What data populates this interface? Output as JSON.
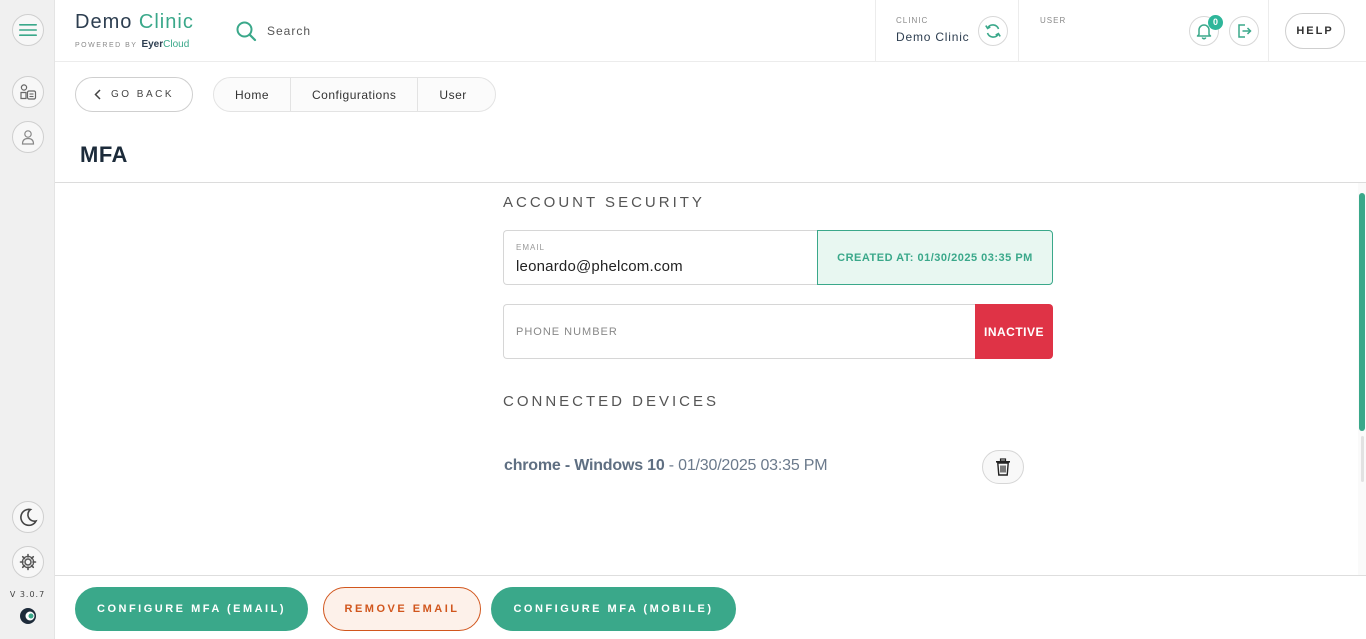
{
  "sidebar": {
    "version": "V 3.0.7"
  },
  "header": {
    "brand_first": "Demo",
    "brand_second": "Clinic",
    "powered_by": "POWERED BY",
    "powered_eyer": "Eyer",
    "powered_cloud": "Cloud",
    "search_placeholder": "Search",
    "clinic_label": "CLINIC",
    "clinic_value": "Demo Clinic",
    "user_label": "USER",
    "notification_count": "0",
    "help_label": "HELP"
  },
  "nav": {
    "go_back_label": "GO BACK",
    "breadcrumb": [
      "Home",
      "Configurations",
      "User"
    ]
  },
  "page": {
    "title": "MFA"
  },
  "account_security": {
    "heading": "ACCOUNT SECURITY",
    "email_label": "EMAIL",
    "email_value": "leonardo@phelcom.com",
    "created_at": "CREATED AT: 01/30/2025 03:35 PM",
    "phone_label": "PHONE NUMBER",
    "phone_status": "INACTIVE"
  },
  "connected_devices": {
    "heading": "CONNECTED DEVICES",
    "devices": [
      {
        "name": "chrome - Windows 10",
        "date": " - 01/30/2025 03:35 PM"
      }
    ]
  },
  "footer": {
    "configure_email": "CONFIGURE MFA (EMAIL)",
    "remove_email": "REMOVE EMAIL",
    "configure_mobile": "CONFIGURE MFA (MOBILE)"
  },
  "colors": {
    "accent": "#3aa88a",
    "danger": "#df3346",
    "warning_outline": "#d1561d",
    "dark_text": "#2d3e50"
  }
}
